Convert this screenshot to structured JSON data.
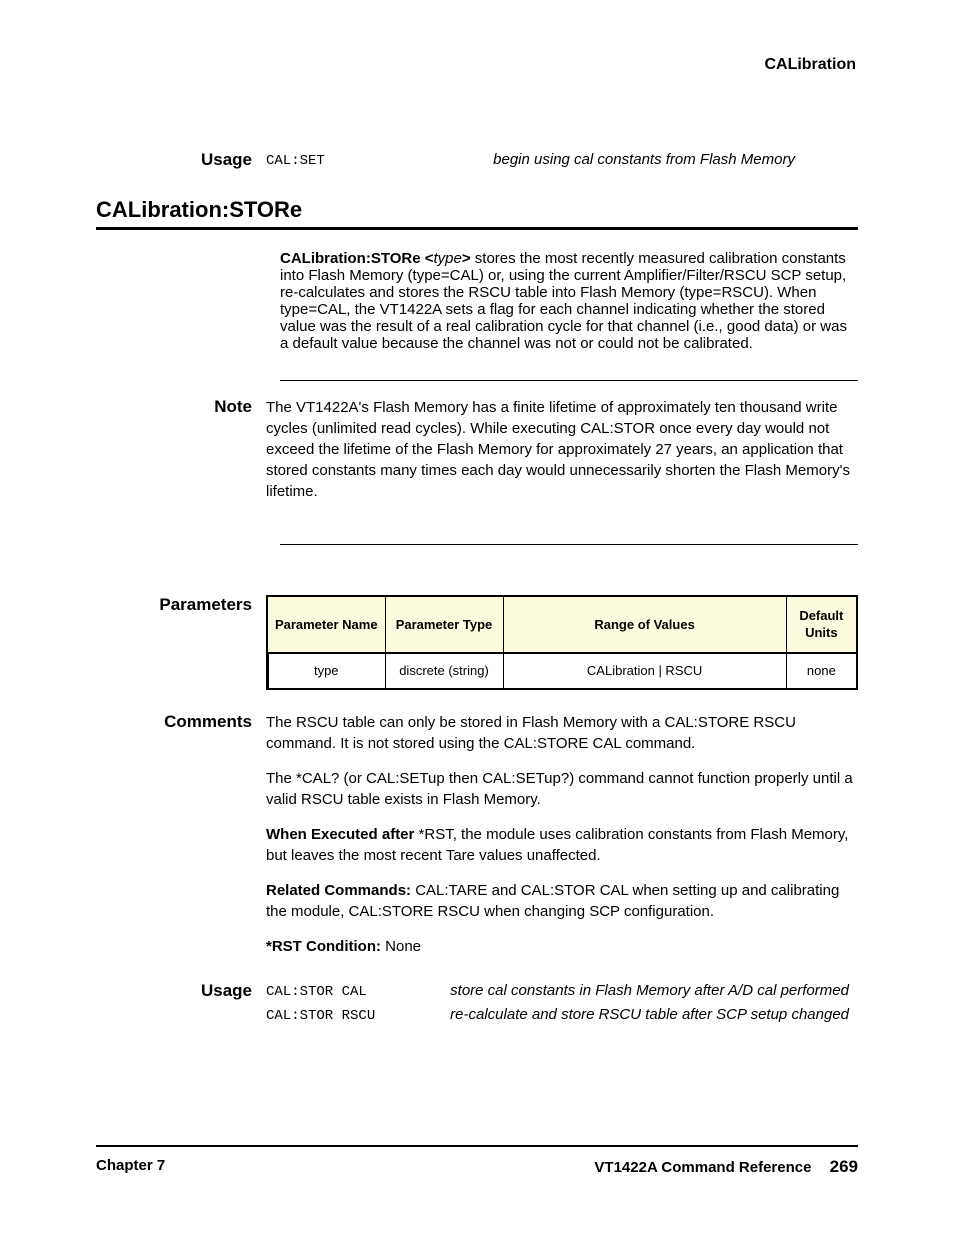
{
  "header": {
    "running": "CALibration"
  },
  "usage1": {
    "label": "Usage",
    "code": "CAL:SET",
    "comment": "begin using cal constants from Flash Memory"
  },
  "section": {
    "title": "CALibration:STORe",
    "syntax_prefix": "CALibration:STORe <",
    "syntax_param": "type",
    "syntax_suffix": ">",
    "desc": " stores the most recently measured calibration constants into Flash Memory (type=CAL) or, using the current Amplifier/Filter/RSCU SCP setup, re-calculates and stores the RSCU table into Flash Memory (type=RSCU). When type=CAL, the VT1422A sets a flag for each channel indicating whether the stored value was the result of a real calibration cycle for that channel (i.e., good data) or was a default value because the channel was not or could not be calibrated."
  },
  "note": {
    "label": "Note",
    "text": "The VT1422A's Flash Memory has a finite lifetime of approximately ten thousand write cycles (unlimited read cycles). While executing CAL:STOR once every day would not exceed the lifetime of the Flash Memory for approximately 27 years, an application that stored constants many times each day would unnecessarily shorten the Flash Memory's lifetime."
  },
  "parameters": {
    "label": "Parameters",
    "headers": {
      "name": "Parameter Name",
      "type": "Parameter Type",
      "range": "Range of Values",
      "default": "Default Units"
    },
    "row": {
      "name": "type",
      "type": "discrete (string)",
      "range": "CALibration | RSCU",
      "default": "none"
    }
  },
  "comments": {
    "label": "Comments",
    "items": [
      {
        "text": "The RSCU table can only be stored in Flash Memory with a CAL:STORE RSCU command. It is not stored using the CAL:STORE CAL command.",
        "bold": ""
      },
      {
        "text": "The *CAL? (or CAL:SETup then CAL:SETup?) command cannot function properly until a valid RSCU table exists in Flash Memory.",
        "bold": ""
      },
      {
        "text": " *RST, the module uses calibration constants from Flash Memory, but leaves the most recent Tare values unaffected.",
        "bold": "When Executed after"
      },
      {
        "text": " CAL:TARE and CAL:STOR CAL when setting up and calibrating the module, CAL:STORE RSCU when changing SCP configuration.",
        "bold": "Related Commands:"
      },
      {
        "text": " None",
        "bold": "*RST Condition:"
      }
    ]
  },
  "usage2": {
    "label": "Usage",
    "rows": [
      {
        "code": "CAL:STOR CAL",
        "comment": "store cal constants in Flash Memory after A/D cal performed"
      },
      {
        "code": "CAL:STOR RSCU",
        "comment": "re-calculate and store RSCU table after SCP setup changed"
      }
    ]
  },
  "footer": {
    "left": "Chapter 7",
    "right": "VT1422A Command Reference",
    "page": "269"
  }
}
